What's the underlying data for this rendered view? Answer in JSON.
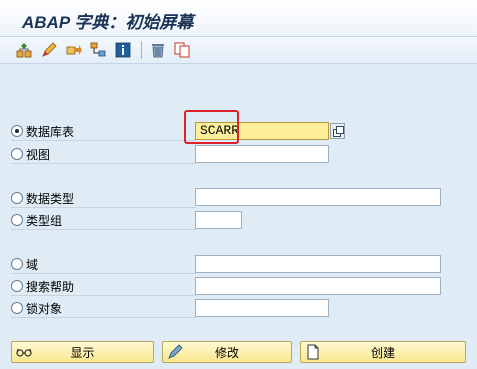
{
  "window": {
    "title": "ABAP 字典：初始屏幕"
  },
  "toolbar": {
    "icons": [
      "object-hierarchy-icon",
      "pencil-icon",
      "transport-icon",
      "hierarchy-icon",
      "info-icon",
      "trash-icon",
      "copy-icon"
    ]
  },
  "options": [
    {
      "label": "数据库表",
      "selected": true,
      "value": "SCARR"
    },
    {
      "label": "视图",
      "selected": false,
      "value": ""
    },
    {
      "label": "数据类型",
      "selected": false,
      "value": ""
    },
    {
      "label": "类型组",
      "selected": false,
      "value": ""
    },
    {
      "label": "域",
      "selected": false,
      "value": ""
    },
    {
      "label": "搜索帮助",
      "selected": false,
      "value": ""
    },
    {
      "label": "锁对象",
      "selected": false,
      "value": ""
    }
  ],
  "buttons": {
    "display": "显示",
    "change": "修改",
    "create": "创建"
  },
  "colors": {
    "background": "#dfebf5",
    "active_field": "#fdef9a",
    "highlight_border": "#e0202a",
    "button": "#f8e88d"
  }
}
